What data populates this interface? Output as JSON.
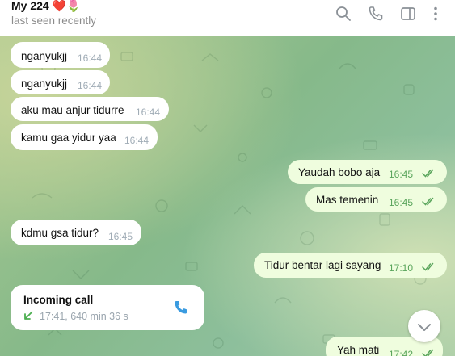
{
  "header": {
    "chat_name": "My 224",
    "name_emojis": "❤️🌷",
    "status": "last seen recently"
  },
  "icons": {
    "search": "search-icon",
    "call": "phone-icon",
    "sidebar": "sidebar-toggle-icon",
    "more": "more-vertical-icon",
    "call_arrow": "call-received-arrow-icon",
    "call_button": "phone-icon",
    "scroll_down": "chevron-down-icon",
    "read_ticks": "double-check-icon"
  },
  "messages": [
    {
      "direction": "incoming",
      "text": "nganyukjj",
      "time": "16:44"
    },
    {
      "direction": "incoming",
      "text": "nganyukjj",
      "time": "16:44"
    },
    {
      "direction": "incoming",
      "text": "aku mau anjur tidurre",
      "time": "16:44"
    },
    {
      "direction": "incoming",
      "text": "kamu gaa yidur yaa",
      "time": "16:44"
    },
    {
      "direction": "outgoing",
      "text": "Yaudah bobo aja",
      "time": "16:45",
      "read": true
    },
    {
      "direction": "outgoing",
      "text": "Mas temenin",
      "time": "16:45",
      "read": true
    },
    {
      "direction": "incoming",
      "text": "kdmu gsa tidur?",
      "time": "16:45"
    },
    {
      "direction": "outgoing",
      "text": "Tidur bentar lagi sayang",
      "time": "17:10",
      "read": true
    },
    {
      "direction": "outgoing",
      "text": "Yah mati",
      "time": "17:42",
      "read": true
    }
  ],
  "call": {
    "title": "Incoming call",
    "details": "17:41, 640 min 36 s"
  },
  "colors": {
    "incoming_bubble": "#ffffff",
    "outgoing_bubble": "#effdde",
    "outgoing_time": "#5aa55c",
    "accent": "#3a9be0"
  }
}
